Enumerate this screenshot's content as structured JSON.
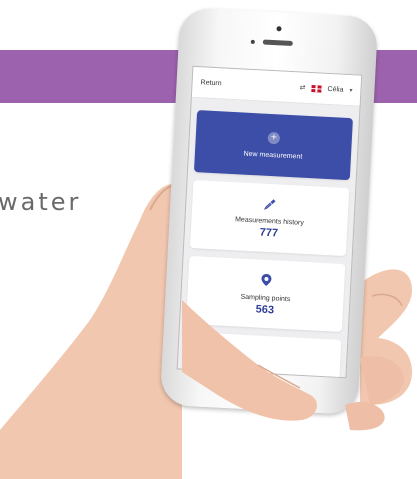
{
  "background": {
    "band_color": "#9c62ad",
    "partial_text": "water"
  },
  "app": {
    "header": {
      "back_label": "Return",
      "sync_icon": "sync-icon",
      "language_flag": "uk-flag-icon",
      "user_name": "Célia",
      "user_menu_icon": "chevron-down-icon"
    },
    "cards": [
      {
        "label": "New measurement",
        "icon": "plus-circle-icon"
      },
      {
        "label": "Measurements history",
        "icon": "pipette-icon",
        "count": "777"
      },
      {
        "label": "Sampling points",
        "icon": "map-pin-icon",
        "count": "563"
      }
    ],
    "accent_color": "#3c4ea8",
    "count_color": "#2c3d96"
  }
}
